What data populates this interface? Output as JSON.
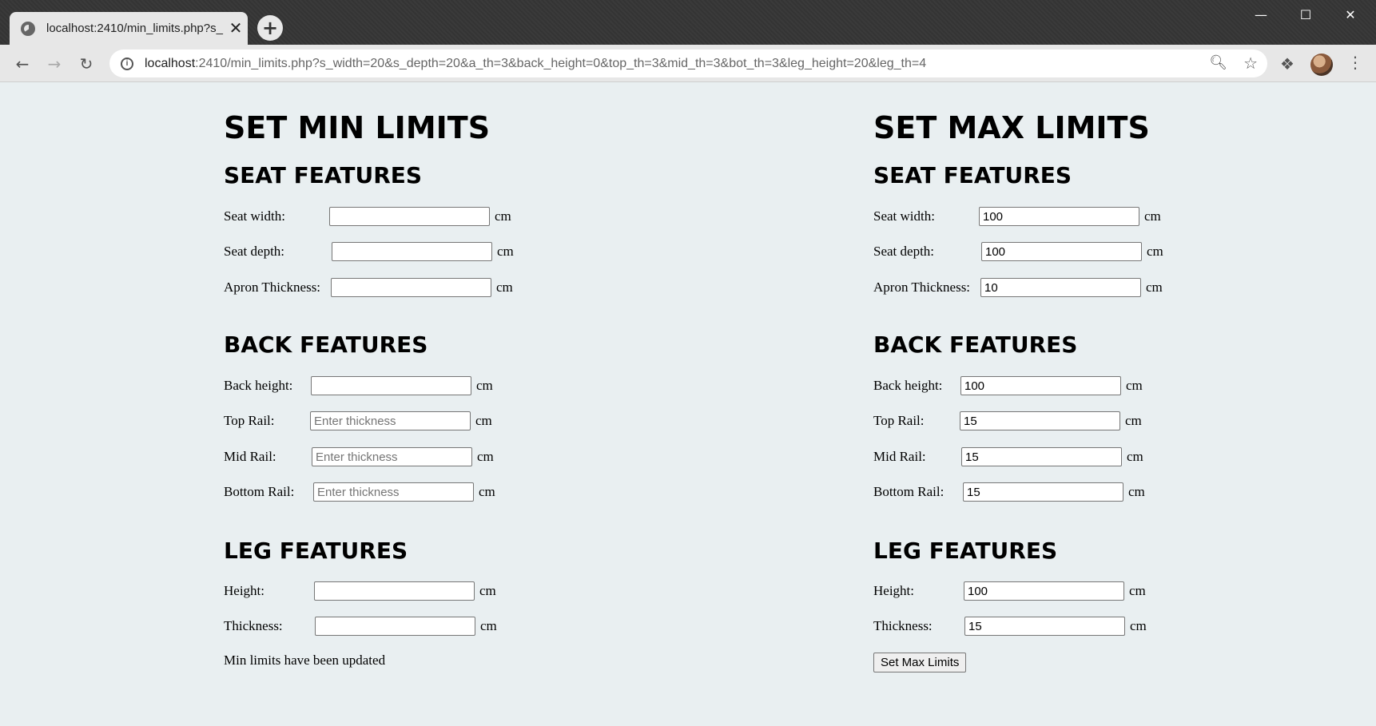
{
  "browser": {
    "tab_title": "localhost:2410/min_limits.php?s_",
    "tab_close": "✕",
    "new_tab": "+",
    "url_host": "localhost",
    "url_rest": ":2410/min_limits.php?s_width=20&s_depth=20&a_th=3&back_height=0&top_th=3&mid_th=3&bot_th=3&leg_height=20&leg_th=4",
    "icons": {
      "back": "back-arrow-icon",
      "forward": "forward-arrow-icon",
      "reload": "reload-icon",
      "info": "info-icon",
      "zoom": "zoom-icon",
      "bookmark": "star-icon",
      "extensions": "puzzle-icon",
      "avatar": "profile-avatar",
      "menu": "kebab-menu-icon"
    }
  },
  "unit": "cm",
  "min": {
    "title": "SET MIN LIMITS",
    "seat": {
      "heading": "SEAT FEATURES",
      "width": {
        "label": "Seat width:",
        "value": "",
        "placeholder": ""
      },
      "depth": {
        "label": "Seat depth:",
        "value": "",
        "placeholder": ""
      },
      "apron": {
        "label": "Apron Thickness:",
        "value": "",
        "placeholder": ""
      }
    },
    "back": {
      "heading": "BACK FEATURES",
      "height": {
        "label": "Back height:",
        "value": "",
        "placeholder": ""
      },
      "top": {
        "label": "Top Rail:",
        "value": "",
        "placeholder": "Enter thickness"
      },
      "mid": {
        "label": "Mid Rail:",
        "value": "",
        "placeholder": "Enter thickness"
      },
      "bottom": {
        "label": "Bottom Rail:",
        "value": "",
        "placeholder": "Enter thickness"
      }
    },
    "leg": {
      "heading": "LEG FEATURES",
      "height": {
        "label": "Height:",
        "value": "",
        "placeholder": ""
      },
      "thickness": {
        "label": "Thickness:",
        "value": "",
        "placeholder": ""
      }
    },
    "message": "Min limits have been updated"
  },
  "max": {
    "title": "SET MAX LIMITS",
    "seat": {
      "heading": "SEAT FEATURES",
      "width": {
        "label": "Seat width:",
        "value": "100"
      },
      "depth": {
        "label": "Seat depth:",
        "value": "100"
      },
      "apron": {
        "label": "Apron Thickness:",
        "value": "10"
      }
    },
    "back": {
      "heading": "BACK FEATURES",
      "height": {
        "label": "Back height:",
        "value": "100"
      },
      "top": {
        "label": "Top Rail:",
        "value": "15"
      },
      "mid": {
        "label": "Mid Rail:",
        "value": "15"
      },
      "bottom": {
        "label": "Bottom Rail:",
        "value": "15"
      }
    },
    "leg": {
      "heading": "LEG FEATURES",
      "height": {
        "label": "Height:",
        "value": "100"
      },
      "thickness": {
        "label": "Thickness:",
        "value": "15"
      }
    },
    "button": "Set Max Limits"
  }
}
